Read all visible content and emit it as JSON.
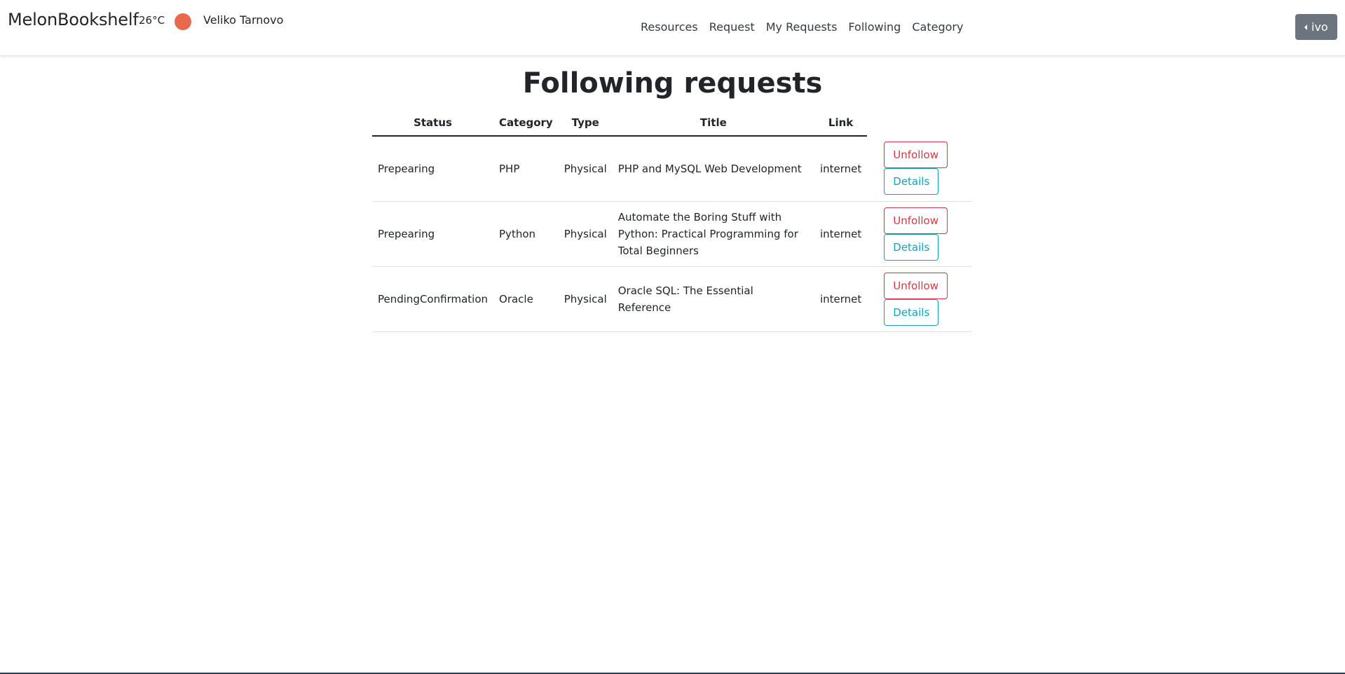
{
  "navbar": {
    "brand": "MelonBookshelf",
    "weather": {
      "temperature": "26°C",
      "icon": "sun-icon",
      "icon_color": "#e8694c",
      "city": "Veliko Tarnovo"
    },
    "links": [
      "Resources",
      "Request",
      "My Requests",
      "Following",
      "Category"
    ],
    "user_button": "ivo"
  },
  "page": {
    "title": "Following requests"
  },
  "table": {
    "headers": {
      "status": "Status",
      "category": "Category",
      "type": "Type",
      "title": "Title",
      "link": "Link"
    },
    "rows": [
      {
        "status": "Prepearing",
        "category": "PHP",
        "type": "Physical",
        "title": "PHP and MySQL Web Development",
        "link": "internet",
        "unfollow": "Unfollow",
        "details": "Details"
      },
      {
        "status": "Prepearing",
        "category": "Python",
        "type": "Physical",
        "title": "Automate the Boring Stuff with Python: Practical Programming for Total Beginners",
        "link": "internet",
        "unfollow": "Unfollow",
        "details": "Details"
      },
      {
        "status": "PendingConfirmation",
        "category": "Oracle",
        "type": "Physical",
        "title": "Oracle SQL: The Essential Reference",
        "link": "internet",
        "unfollow": "Unfollow",
        "details": "Details"
      }
    ]
  },
  "colors": {
    "danger": "#dc3545",
    "info": "#17a2b8",
    "secondary": "#6c757d"
  }
}
